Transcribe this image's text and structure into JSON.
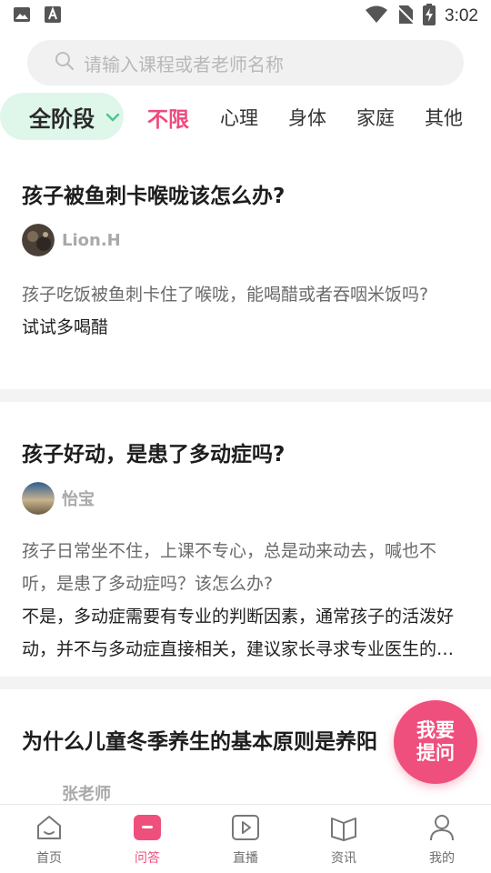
{
  "status_bar": {
    "time": "3:02"
  },
  "search": {
    "placeholder": "请输入课程或者老师名称"
  },
  "filters": {
    "stage": "全阶段",
    "tabs": [
      "不限",
      "心理",
      "身体",
      "家庭",
      "其他"
    ],
    "active_tab": "不限"
  },
  "questions": [
    {
      "title": "孩子被鱼刺卡喉咙该怎么办?",
      "author": "Lion.H",
      "question": "孩子吃饭被鱼刺卡住了喉咙，能喝醋或者吞咽米饭吗?",
      "answer": "试试多喝醋"
    },
    {
      "title": "孩子好动，是患了多动症吗?",
      "author": "怡宝",
      "question": "孩子日常坐不住，上课不专心，总是动来动去，喊也不听，是患了多动症吗？该怎么办?",
      "answer": "不是，多动症需要有专业的判断因素，通常孩子的活泼好动，并不与多动症直接相关，建议家长寻求专业医生的帮助。"
    },
    {
      "title": "为什么儿童冬季养生的基本原则是养阳",
      "author": "张老师"
    }
  ],
  "fab": {
    "label": "我要提问"
  },
  "tabbar": {
    "items": [
      "首页",
      "问答",
      "直播",
      "资讯",
      "我的"
    ],
    "active": "问答"
  },
  "colors": {
    "accent": "#ef4f7c",
    "stage_pill_bg": "#dff7ea",
    "divider": "#f3f3f3"
  }
}
